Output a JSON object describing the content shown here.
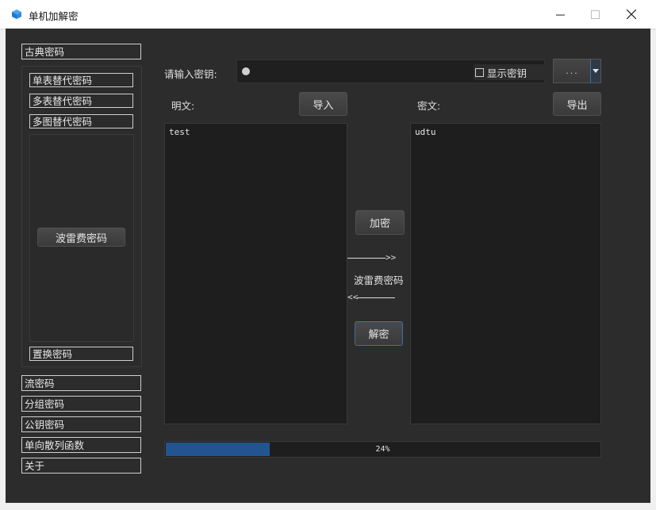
{
  "window": {
    "title": "单机加解密",
    "accent_color": "#22558f"
  },
  "sidebar": {
    "items": [
      {
        "label": "古典密码"
      },
      {
        "label": "单表替代密码"
      },
      {
        "label": "多表替代密码"
      },
      {
        "label": "多图替代密码"
      },
      {
        "label": "波雷费密码"
      },
      {
        "label": "置换密码"
      },
      {
        "label": "流密码"
      },
      {
        "label": "分组密码"
      },
      {
        "label": "公钥密码"
      },
      {
        "label": "单向散列函数"
      },
      {
        "label": "关于"
      }
    ]
  },
  "key": {
    "label": "请输入密钥:",
    "show_key_label": "显示密钥",
    "show_key_checked": false,
    "combo_text": "..."
  },
  "plaintext": {
    "label": "明文:",
    "import_label": "导入",
    "value": "test"
  },
  "ciphertext": {
    "label": "密文:",
    "export_label": "导出",
    "value": "udtu"
  },
  "actions": {
    "encrypt_label": "加密",
    "decrypt_label": "解密",
    "cipher_name": "波雷费密码",
    "arrow_right_head": ">>",
    "arrow_left_head": "<<"
  },
  "progress": {
    "value": 24,
    "text": "24%"
  }
}
